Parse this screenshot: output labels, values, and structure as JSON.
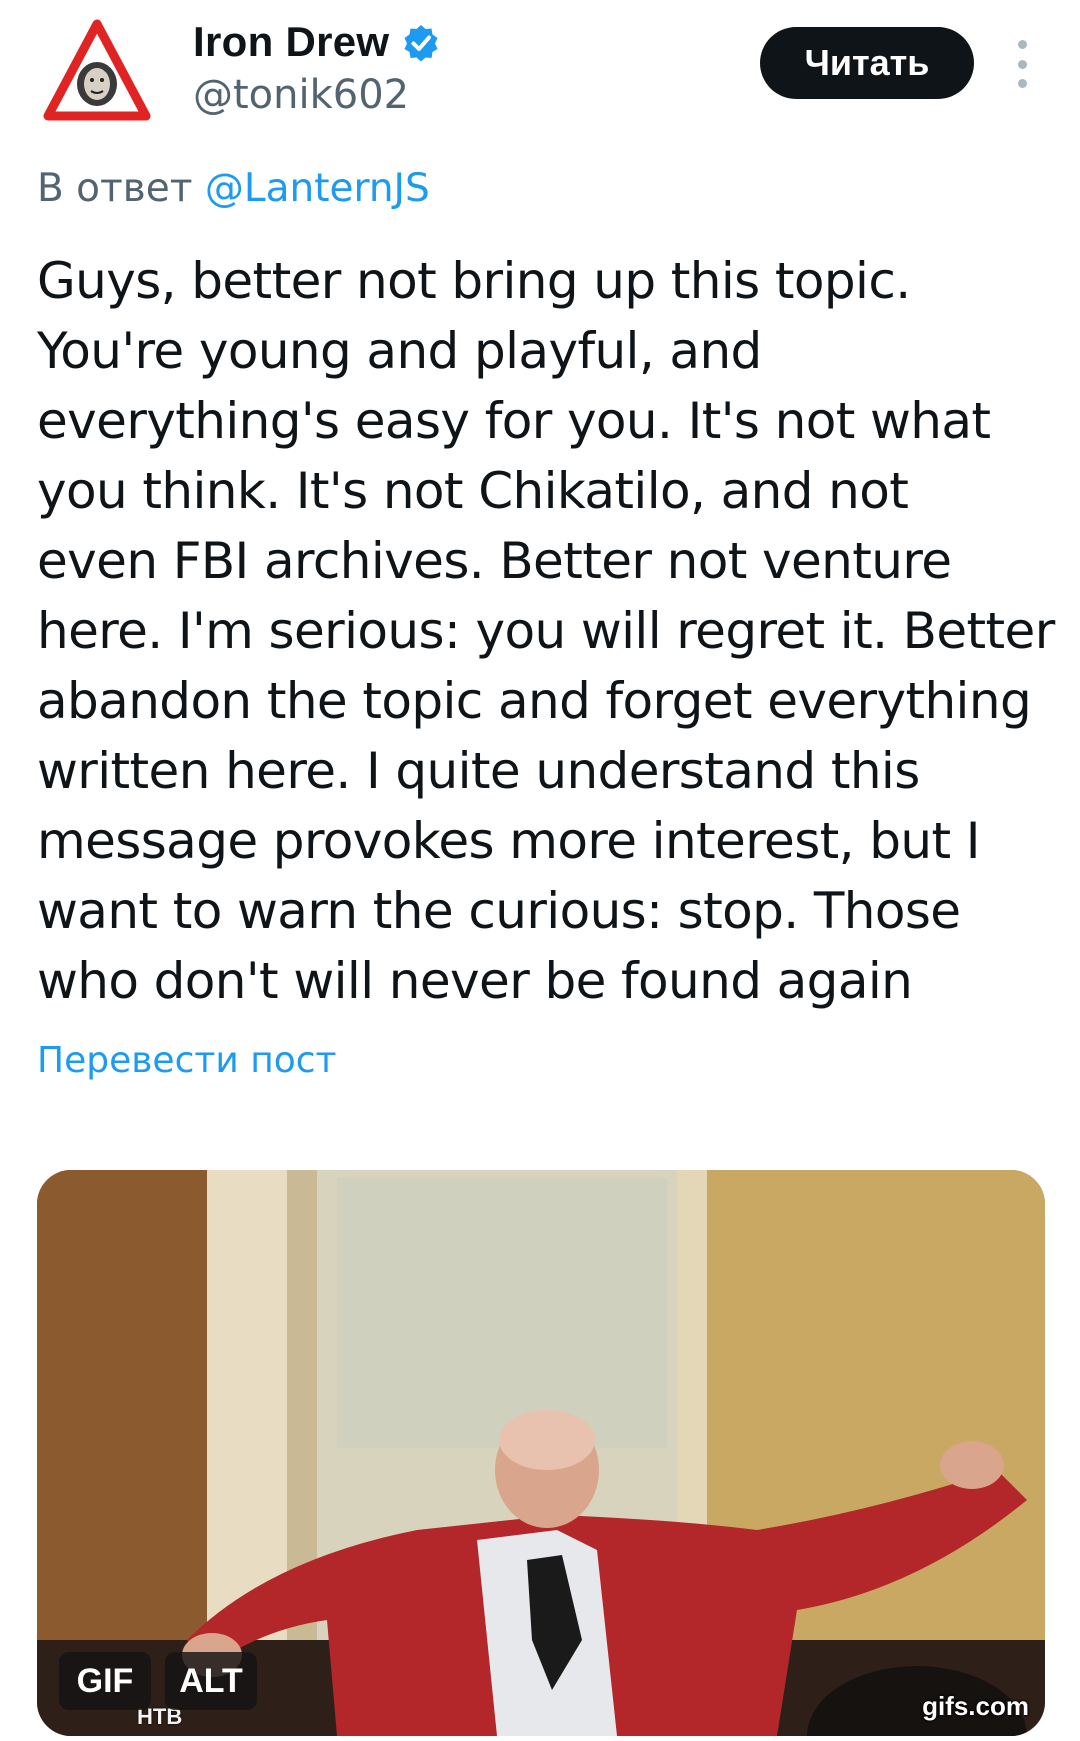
{
  "author": {
    "display_name": "Iron Drew",
    "handle": "@tonik602",
    "verified_icon": "verified-badge-icon"
  },
  "actions": {
    "follow_label": "Читать",
    "more_icon": "more-vertical-icon"
  },
  "reply": {
    "prefix": "В ответ",
    "mention": "@LanternJS"
  },
  "tweet": {
    "text": "Guys, better not bring up this topic.\nYou're young and playful, and\neverything's easy for you. It's not what\nyou think. It's not Chikatilo, and not\neven FBI archives. Better not venture\nhere. I'm serious: you will regret it. Better\nabandon the topic and forget everything\nwritten here. I quite understand this\nmessage provokes more interest, but I\nwant to warn the curious: stop. Those\nwho don't will never be found again",
    "translate_label": "Перевести пост"
  },
  "media": {
    "gif_badge": "GIF",
    "alt_badge": "ALT",
    "watermark": "gifs.com",
    "channel_logo": "НТВ"
  },
  "colors": {
    "accent": "#1d9bf0",
    "text": "#0f1419",
    "secondary": "#536471",
    "button_bg": "#0f1419"
  }
}
